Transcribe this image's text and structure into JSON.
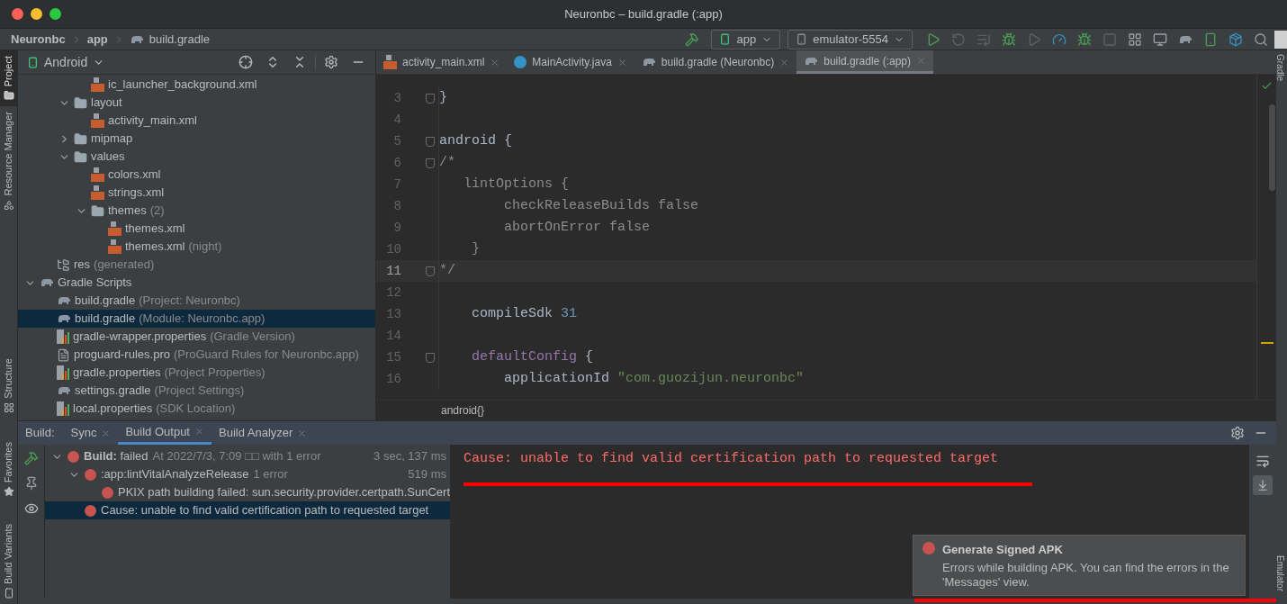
{
  "window": {
    "title": "Neuronbc – build.gradle (:app)"
  },
  "breadcrumb": [
    {
      "label": "Neuronbc",
      "kind": "project"
    },
    {
      "label": "app",
      "kind": "module"
    },
    {
      "label": "build.gradle",
      "kind": "gradle"
    }
  ],
  "toolbar": {
    "config": "app",
    "device": "emulator-5554"
  },
  "left_strip": [
    {
      "label": "Project",
      "selected": true
    },
    {
      "label": "Resource Manager",
      "selected": false
    },
    {
      "label": "Structure",
      "selected": false
    }
  ],
  "left_strip_bottom": [
    {
      "label": "Favorites"
    },
    {
      "label": "Build Variants"
    }
  ],
  "right_strip": [
    {
      "label": "Gradle"
    },
    {
      "label": "Emulator"
    }
  ],
  "project": {
    "view": "Android",
    "tree": [
      {
        "children": [
          {
            "children": [
              {
                "children": [
                  {
                    "label": "ic_launcher_background.xml",
                    "kind": "xml",
                    "selected": false
                  }
                ]
              },
              {
                "label": "layout",
                "kind": "folder",
                "expanded": true,
                "selected": false,
                "children": [
                  {
                    "label": "activity_main.xml",
                    "kind": "xml",
                    "selected": false
                  }
                ]
              },
              {
                "label": "mipmap",
                "kind": "folder",
                "expanded": false,
                "selected": false
              },
              {
                "label": "values",
                "kind": "folder",
                "expanded": true,
                "selected": false,
                "children": [
                  {
                    "label": "colors.xml",
                    "kind": "xml",
                    "selected": false
                  },
                  {
                    "label": "strings.xml",
                    "kind": "xml",
                    "selected": false
                  },
                  {
                    "label": "themes",
                    "detail": "(2)",
                    "kind": "folder",
                    "expanded": true,
                    "selected": false,
                    "children": [
                      {
                        "label": "themes.xml",
                        "kind": "xml",
                        "selected": false
                      },
                      {
                        "label": "themes.xml",
                        "detail": "(night)",
                        "kind": "xml",
                        "selected": false
                      }
                    ]
                  }
                ]
              }
            ]
          },
          {
            "label": "res",
            "detail": "(generated)",
            "kind": "res",
            "selected": false
          }
        ]
      },
      {
        "label": "Gradle Scripts",
        "kind": "gradle",
        "expanded": true,
        "selected": false,
        "children": [
          {
            "label": "build.gradle",
            "detail": "(Project: Neuronbc)",
            "kind": "gradle",
            "selected": false
          },
          {
            "label": "build.gradle",
            "detail": "(Module: Neuronbc.app)",
            "kind": "gradle",
            "selected": true
          },
          {
            "label": "gradle-wrapper.properties",
            "detail": "(Gradle Version)",
            "kind": "properties",
            "selected": false
          },
          {
            "label": "proguard-rules.pro",
            "detail": "(ProGuard Rules for Neuronbc.app)",
            "kind": "file",
            "selected": false
          },
          {
            "label": "gradle.properties",
            "detail": "(Project Properties)",
            "kind": "properties",
            "selected": false
          },
          {
            "label": "settings.gradle",
            "detail": "(Project Settings)",
            "kind": "gradle",
            "selected": false
          },
          {
            "label": "local.properties",
            "detail": "(SDK Location)",
            "kind": "properties",
            "selected": false
          }
        ]
      }
    ]
  },
  "editor_tabs": [
    {
      "label": "activity_main.xml",
      "kind": "xml",
      "selected": false
    },
    {
      "label": "MainActivity.java",
      "kind": "java",
      "selected": false
    },
    {
      "label": "build.gradle (Neuronbc)",
      "kind": "gradle",
      "selected": false
    },
    {
      "label": "build.gradle (:app)",
      "kind": "gradle",
      "selected": true
    }
  ],
  "code": [
    {
      "number": "3",
      "fold": true,
      "current": false,
      "tokens": [
        {
          "text": "}",
          "kind": "plain"
        }
      ]
    },
    {
      "number": "4",
      "fold": false,
      "current": false
    },
    {
      "number": "5",
      "fold": true,
      "current": false,
      "tokens": [
        {
          "text": "android {",
          "kind": "plain"
        }
      ]
    },
    {
      "number": "6",
      "fold": true,
      "current": false,
      "tokens": [
        {
          "text": "/*",
          "kind": "comment"
        }
      ]
    },
    {
      "number": "7",
      "fold": false,
      "current": false,
      "tokens": [
        {
          "text": "   lintOptions {",
          "kind": "comment"
        }
      ]
    },
    {
      "number": "8",
      "fold": false,
      "current": false,
      "tokens": [
        {
          "text": "        checkReleaseBuilds false",
          "kind": "comment"
        }
      ]
    },
    {
      "number": "9",
      "fold": false,
      "current": false,
      "tokens": [
        {
          "text": "        abortOnError false",
          "kind": "comment"
        }
      ]
    },
    {
      "number": "10",
      "fold": false,
      "current": false,
      "tokens": [
        {
          "text": "    }",
          "kind": "comment"
        }
      ]
    },
    {
      "number": "11",
      "fold": true,
      "current": true,
      "tokens": [
        {
          "text": "*/",
          "kind": "comment"
        }
      ]
    },
    {
      "number": "12",
      "fold": false,
      "current": false
    },
    {
      "number": "13",
      "fold": false,
      "current": false,
      "tokens": [
        {
          "text": "    compileSdk ",
          "kind": "plain"
        },
        {
          "text": "31",
          "kind": "number"
        }
      ]
    },
    {
      "number": "14",
      "fold": false,
      "current": false
    },
    {
      "number": "15",
      "fold": true,
      "current": false,
      "tokens": [
        {
          "text": "    defaultConfig",
          "kind": "keyword"
        },
        {
          "text": " {",
          "kind": "plain"
        }
      ]
    },
    {
      "number": "16",
      "fold": false,
      "current": false,
      "tokens": [
        {
          "text": "        applicationId ",
          "kind": "plain"
        },
        {
          "text": "\"com.guozijun.neuronbc\"",
          "kind": "string"
        }
      ]
    }
  ],
  "editor_breadcrumb": "android{}",
  "build": {
    "label": "Build:",
    "tabs": [
      {
        "label": "Sync",
        "selected": false
      },
      {
        "label": "Build Output",
        "selected": true
      },
      {
        "label": "Build Analyzer",
        "selected": false
      }
    ],
    "tree": [
      {
        "text": "**Build:** failed",
        "detail": "At 2022/7/3, 7:09 □□ with 1 error",
        "time": "3 sec, 137 ms",
        "expanded": true,
        "selected": false,
        "children": [
          {
            "text": ":app:lintVitalAnalyzeRelease",
            "detail": "1 error",
            "time": "519 ms",
            "expanded": true,
            "selected": false,
            "children": [
              {
                "text": "PKIX path building failed: sun.security.provider.certpath.SunCert",
                "selected": false
              }
            ]
          },
          {
            "text": "Cause: unable to find valid certification path to requested target",
            "selected": true
          }
        ]
      }
    ],
    "console": "Cause: unable to find valid certification path to requested target"
  },
  "notification": {
    "title": "Generate Signed APK",
    "body": "Errors while building APK. You can find the errors in the 'Messages' view."
  }
}
